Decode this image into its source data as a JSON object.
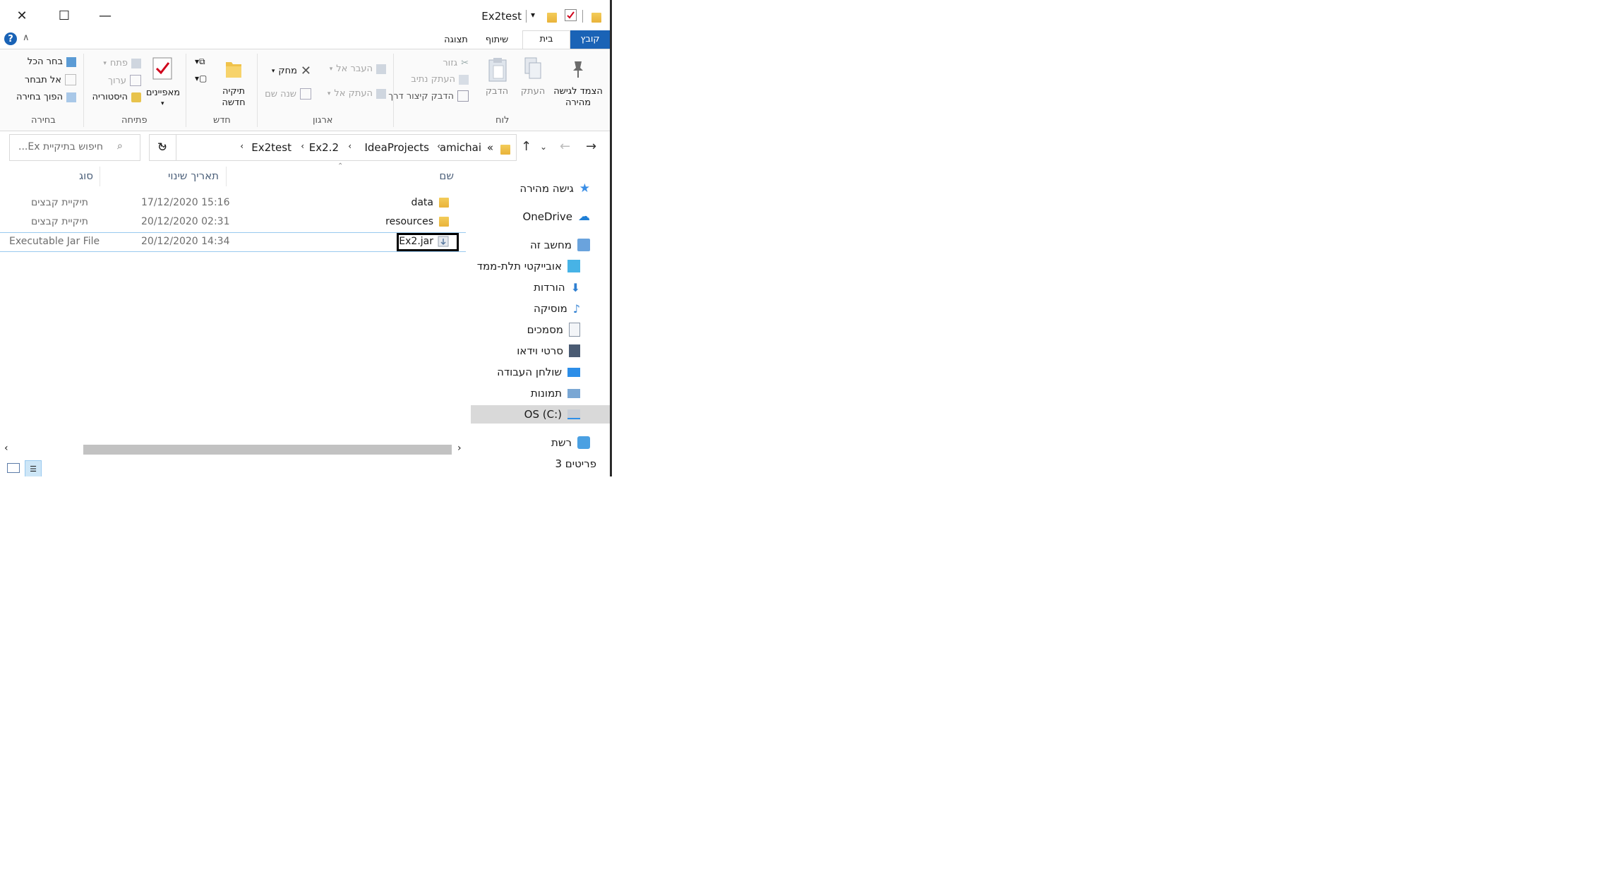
{
  "window": {
    "title": "Ex2test",
    "controls": {
      "close": "✕",
      "maximize": "☐",
      "minimize": "—"
    }
  },
  "tabs": [
    {
      "label": "קובץ"
    },
    {
      "label": "בית"
    },
    {
      "label": "שיתוף"
    },
    {
      "label": "תצוגה"
    }
  ],
  "ribbon": {
    "clipboard": {
      "label": "לוח",
      "pin": "הצמד לגישה מהירה",
      "copy": "העתק",
      "paste": "הדבק",
      "cut": "גזור",
      "copy_path": "העתק נתיב",
      "paste_shortcut": "הדבק קיצור דרך"
    },
    "organize": {
      "label": "ארגון",
      "move_to": "העבר אל",
      "copy_to": "העתק אל",
      "delete": "מחק",
      "rename": "שנה שם"
    },
    "new": {
      "label": "חדש",
      "new_folder": "תיקיה חדשה"
    },
    "open": {
      "label": "פתיחה",
      "properties": "מאפיינים",
      "open": "פתח",
      "edit": "ערוך",
      "history": "היסטוריה"
    },
    "select": {
      "label": "בחירה",
      "select_all": "בחר הכל",
      "select_none": "אל תבחר",
      "invert": "הפוך בחירה"
    }
  },
  "address": {
    "crumbs": [
      "amichai",
      "IdeaProjects",
      "Ex2.2",
      "Ex2test"
    ],
    "overflow": "«",
    "search_placeholder": "...Ex חיפוש בתיקיית"
  },
  "columns": {
    "name": "שם",
    "modified": "תאריך שינוי",
    "type": "סוג"
  },
  "files": [
    {
      "name": "data",
      "modified": "17/12/2020 15:16",
      "type": "תיקיית קבצים"
    },
    {
      "name": "resources",
      "modified": "20/12/2020 02:31",
      "type": "תיקיית קבצים"
    },
    {
      "name": "Ex2.jar",
      "modified": "20/12/2020 14:34",
      "type": "Executable Jar File"
    }
  ],
  "nav": {
    "quick_access": "גישה מהירה",
    "onedrive": "OneDrive",
    "this_pc": "מחשב זה",
    "objects3d": "אובייקטי תלת-ממד",
    "downloads": "הורדות",
    "music": "מוסיקה",
    "documents": "מסמכים",
    "videos": "סרטי וידאו",
    "desktop": "שולחן העבודה",
    "pictures": "תמונות",
    "os_c": "OS (C:)",
    "network": "רשת"
  },
  "status": {
    "items": "3 פריטים"
  },
  "colors": {
    "accent": "#1a63b6",
    "folder": "#e9b33a"
  }
}
